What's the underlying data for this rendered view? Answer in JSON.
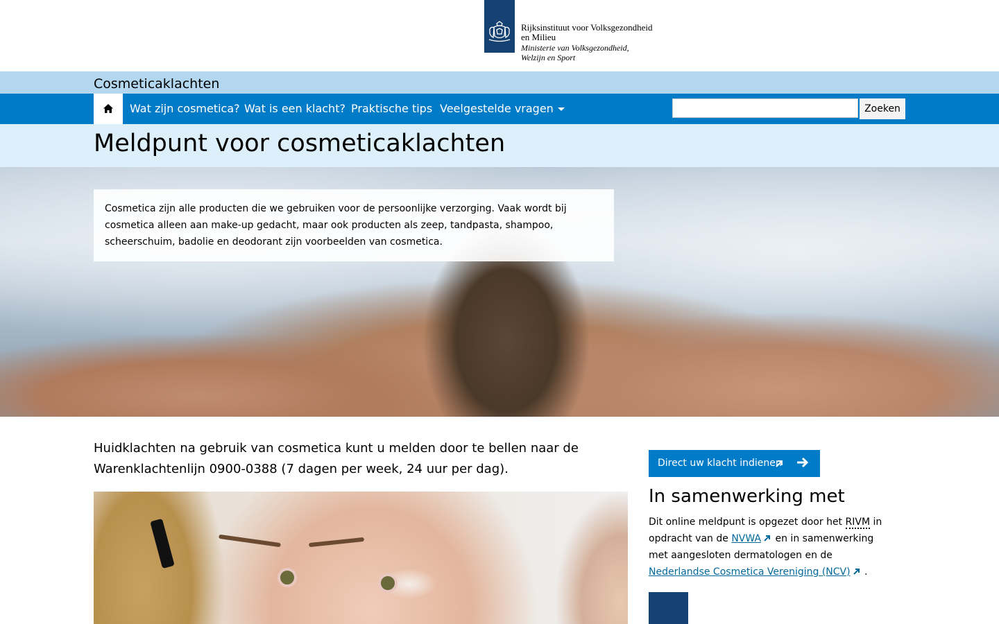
{
  "header": {
    "org_name_line1": "Rijksinstituut voor Volksgezondheid",
    "org_name_line2": "en Milieu",
    "ministry_line1": "Ministerie van Volksgezondheid,",
    "ministry_line2": "Welzijn en Sport",
    "logo_color": "#154273"
  },
  "site": {
    "title": "Cosmeticaklachten"
  },
  "nav": {
    "home_icon": "home-icon",
    "items": [
      {
        "label": "Wat zijn cosmetica?"
      },
      {
        "label": "Wat is een klacht?"
      },
      {
        "label": "Praktische tips"
      },
      {
        "label": "Veelgestelde vragen"
      }
    ],
    "search": {
      "value": "",
      "button_label": "Zoeken"
    },
    "color": "#007bc7"
  },
  "page": {
    "title": "Meldpunt voor cosmeticaklachten",
    "intro": "Cosmetica zijn alle producten die we gebruiken voor de persoonlijke verzorging. Vaak wordt bij cosmetica alleen aan make-up gedacht, maar ook producten als zeep, tandpasta, shampoo, scheerschuim, badolie en deodorant zijn voorbeelden van cosmetica.",
    "lead": "Huidklachten na gebruik van cosmetica kunt u melden door te bellen naar de Warenklachtenlijn 0900-0388 (7 dagen per week, 24 uur per dag)."
  },
  "aside": {
    "cta_label": "Direct uw klacht indienen",
    "title": "In samenwerking met",
    "text_1": "Dit online meldpunt is opgezet door het",
    "abbr_rivm": "RIVM",
    "text_2": "in opdracht van de",
    "link_nvwa": "NVWA",
    "text_3": "en in samenwerking met aangesloten dermatologen en de",
    "link_ncv": "Nederlandse Cosmetica Vereniging (NCV)",
    "text_4": "."
  }
}
